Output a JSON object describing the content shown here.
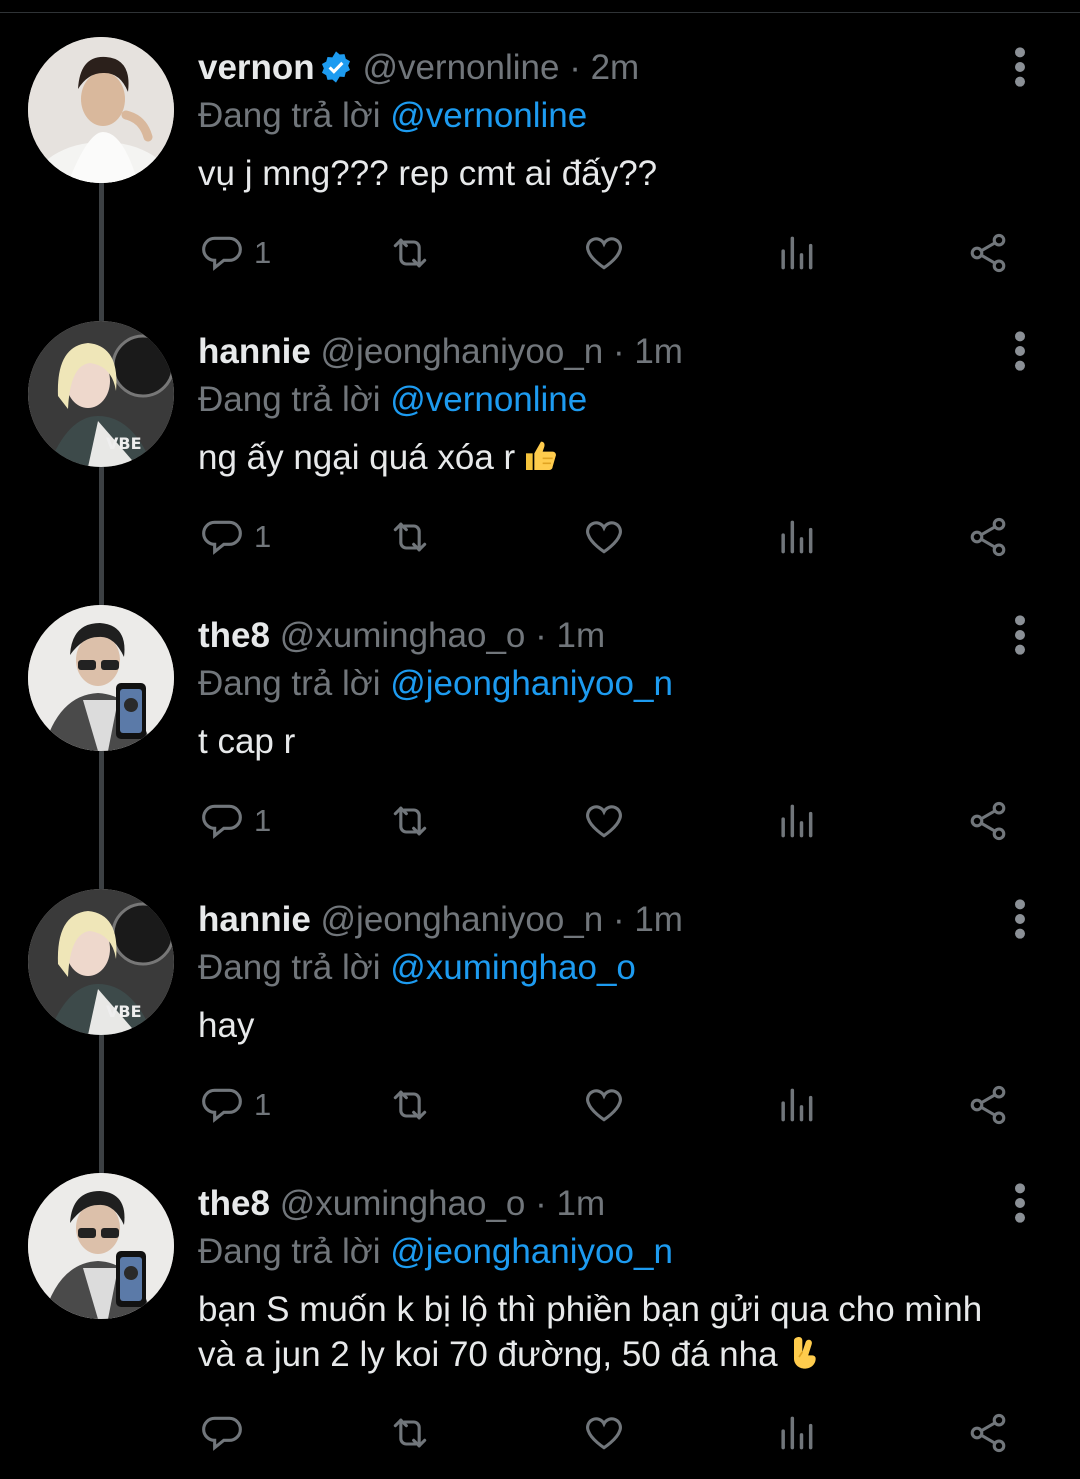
{
  "replying_prefix": "Đang trả lời",
  "tweets": [
    {
      "name": "vernon",
      "verified": true,
      "handle": "@vernonline",
      "time": "2m",
      "replying_to": "@vernonline",
      "text": "vụ j mng??? rep cmt ai đấy??",
      "reply_count": "1",
      "avatar_icon": "avatar-vernon",
      "trailing_emoji": ""
    },
    {
      "name": "hannie",
      "verified": false,
      "handle": "@jeonghaniyoo_n",
      "time": "1m",
      "replying_to": "@vernonline",
      "text": "ng ấy ngại quá xóa r",
      "reply_count": "1",
      "avatar_icon": "avatar-hannie",
      "trailing_emoji": "thumbs-up-emoji"
    },
    {
      "name": "the8",
      "verified": false,
      "handle": "@xuminghao_o",
      "time": "1m",
      "replying_to": "@jeonghaniyoo_n",
      "text": "t cap r",
      "reply_count": "1",
      "avatar_icon": "avatar-the8",
      "trailing_emoji": ""
    },
    {
      "name": "hannie",
      "verified": false,
      "handle": "@jeonghaniyoo_n",
      "time": "1m",
      "replying_to": "@xuminghao_o",
      "text": "hay",
      "reply_count": "1",
      "avatar_icon": "avatar-hannie",
      "trailing_emoji": ""
    },
    {
      "name": "the8",
      "verified": false,
      "handle": "@xuminghao_o",
      "time": "1m",
      "replying_to": "@jeonghaniyoo_n",
      "text": "bạn S muốn k bị lộ thì phiền bạn gửi qua cho mình và a jun 2 ly koi 70 đường, 50 đá nha",
      "reply_count": "",
      "avatar_icon": "avatar-the8",
      "trailing_emoji": "crossed-fingers-emoji"
    }
  ],
  "colors": {
    "background": "#000000",
    "text": "#e7e9ea",
    "muted": "#71767b",
    "link": "#1d9bf0",
    "thread_line": "#3c4043"
  }
}
